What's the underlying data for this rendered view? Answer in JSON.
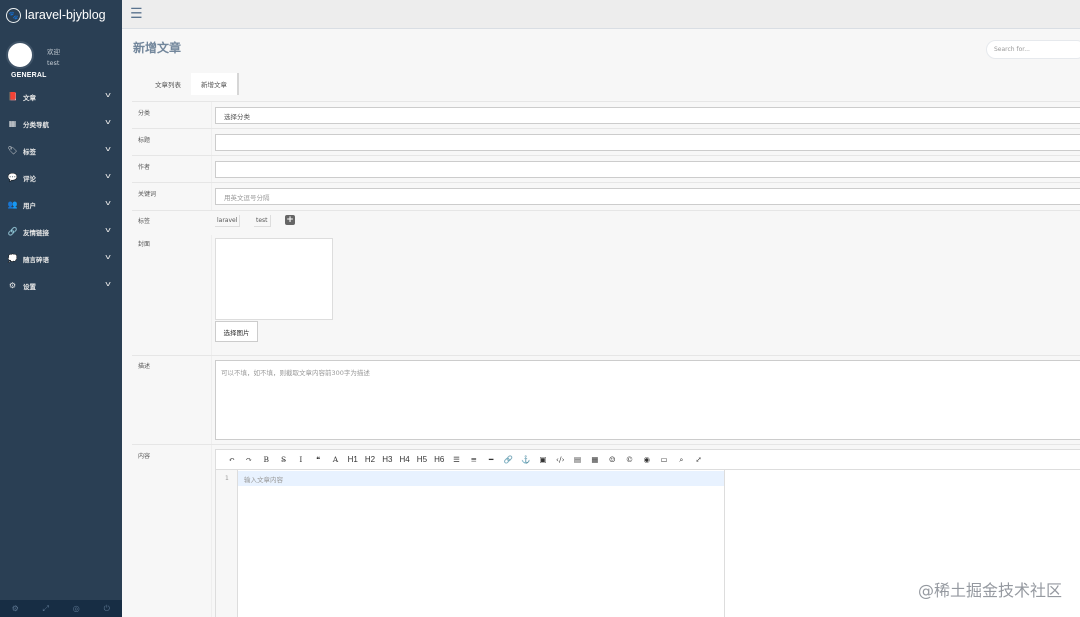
{
  "brand": {
    "logo_icon": "🐾",
    "title": "laravel-bjyblog"
  },
  "profile": {
    "welcome": "欢迎",
    "username": "test"
  },
  "sidebar": {
    "section": "GENERAL",
    "items": [
      {
        "icon": "book-icon",
        "glyph": "📕",
        "label": "文章"
      },
      {
        "icon": "grid-icon",
        "glyph": "▦",
        "label": "分类导航"
      },
      {
        "icon": "tags-icon",
        "glyph": "🏷",
        "label": "标签"
      },
      {
        "icon": "comments-icon",
        "glyph": "💬",
        "label": "评论"
      },
      {
        "icon": "users-icon",
        "glyph": "👥",
        "label": "用户"
      },
      {
        "icon": "link-icon",
        "glyph": "🔗",
        "label": "友情链接"
      },
      {
        "icon": "chat-icon",
        "glyph": "💭",
        "label": "随言碎语"
      },
      {
        "icon": "cogs-icon",
        "glyph": "⚙",
        "label": "设置"
      }
    ],
    "footer": [
      {
        "icon": "gear-icon",
        "glyph": "⚙"
      },
      {
        "icon": "fullscreen-icon",
        "glyph": "⤢"
      },
      {
        "icon": "eye-slash-icon",
        "glyph": "◎"
      },
      {
        "icon": "power-icon",
        "glyph": "⏻"
      }
    ]
  },
  "topnav": {
    "toggle_glyph": "☰"
  },
  "page": {
    "title": "新增文章",
    "search_placeholder": "Search for..."
  },
  "tabs": [
    {
      "label": "文章列表",
      "active": false
    },
    {
      "label": "新增文章",
      "active": true
    }
  ],
  "form": {
    "category": {
      "label": "分类",
      "value": "选择分类"
    },
    "title": {
      "label": "标题",
      "value": ""
    },
    "author": {
      "label": "作者",
      "value": ""
    },
    "keywords": {
      "label": "关键词",
      "placeholder": "用英文逗号分隔"
    },
    "tags": {
      "label": "标签",
      "values": [
        "laravel",
        "test"
      ],
      "add_glyph": "+"
    },
    "cover": {
      "label": "封面",
      "button": "选择图片"
    },
    "description": {
      "label": "描述",
      "placeholder": "可以不填，如不填，则截取文章内容前300字为描述"
    },
    "content": {
      "label": "内容",
      "line_number": "1",
      "placeholder": "输入文章内容"
    }
  },
  "editor_toolbar": [
    {
      "name": "undo",
      "glyph": "↶"
    },
    {
      "name": "redo",
      "glyph": "↷"
    },
    {
      "name": "bold",
      "glyph": "B"
    },
    {
      "name": "strikethrough",
      "glyph": "S̶"
    },
    {
      "name": "italic",
      "glyph": "I"
    },
    {
      "name": "quote",
      "glyph": "❝"
    },
    {
      "name": "uppercase",
      "glyph": "A"
    },
    {
      "name": "h1",
      "glyph": "H1"
    },
    {
      "name": "h2",
      "glyph": "H2"
    },
    {
      "name": "h3",
      "glyph": "H3"
    },
    {
      "name": "h4",
      "glyph": "H4"
    },
    {
      "name": "h5",
      "glyph": "H5"
    },
    {
      "name": "h6",
      "glyph": "H6"
    },
    {
      "name": "list-ul",
      "glyph": "☰"
    },
    {
      "name": "list-ol",
      "glyph": "≡"
    },
    {
      "name": "hr",
      "glyph": "━"
    },
    {
      "name": "link",
      "glyph": "🔗"
    },
    {
      "name": "anchor",
      "glyph": "⚓"
    },
    {
      "name": "image",
      "glyph": "▣"
    },
    {
      "name": "code",
      "glyph": "‹/›"
    },
    {
      "name": "code-block",
      "glyph": "▤"
    },
    {
      "name": "table",
      "glyph": "▦"
    },
    {
      "name": "emoji",
      "glyph": "☺"
    },
    {
      "name": "html-entities",
      "glyph": "©"
    },
    {
      "name": "watch",
      "glyph": "◉"
    },
    {
      "name": "preview",
      "glyph": "▭"
    },
    {
      "name": "search",
      "glyph": "⌕"
    },
    {
      "name": "fullscreen",
      "glyph": "⤢"
    }
  ],
  "watermark": "@稀土掘金技术社区"
}
